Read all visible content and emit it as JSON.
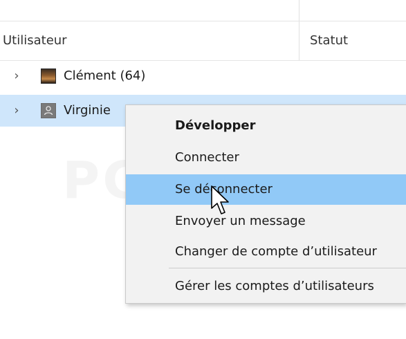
{
  "header": {
    "user_col": "Utilisateur",
    "status_col": "Statut"
  },
  "users": [
    {
      "name": "Clément (64)",
      "avatar": "user-photo"
    },
    {
      "name": "Virginie",
      "avatar": "generic-user-icon"
    }
  ],
  "context_menu": {
    "items": [
      {
        "label": "Développer",
        "bold": true
      },
      {
        "label": "Connecter"
      },
      {
        "label": "Se déconnecter",
        "hovered": true
      },
      {
        "label": "Envoyer un message"
      },
      {
        "label": "Changer de compte d’utilisateur"
      },
      {
        "label": "Gérer les comptes d’utilisateurs"
      }
    ]
  },
  "watermark": "PC ASTUCES",
  "colors": {
    "selected_row": "#cfe6fb",
    "menu_hover": "#91c9f7",
    "menu_bg": "#f2f2f2"
  }
}
